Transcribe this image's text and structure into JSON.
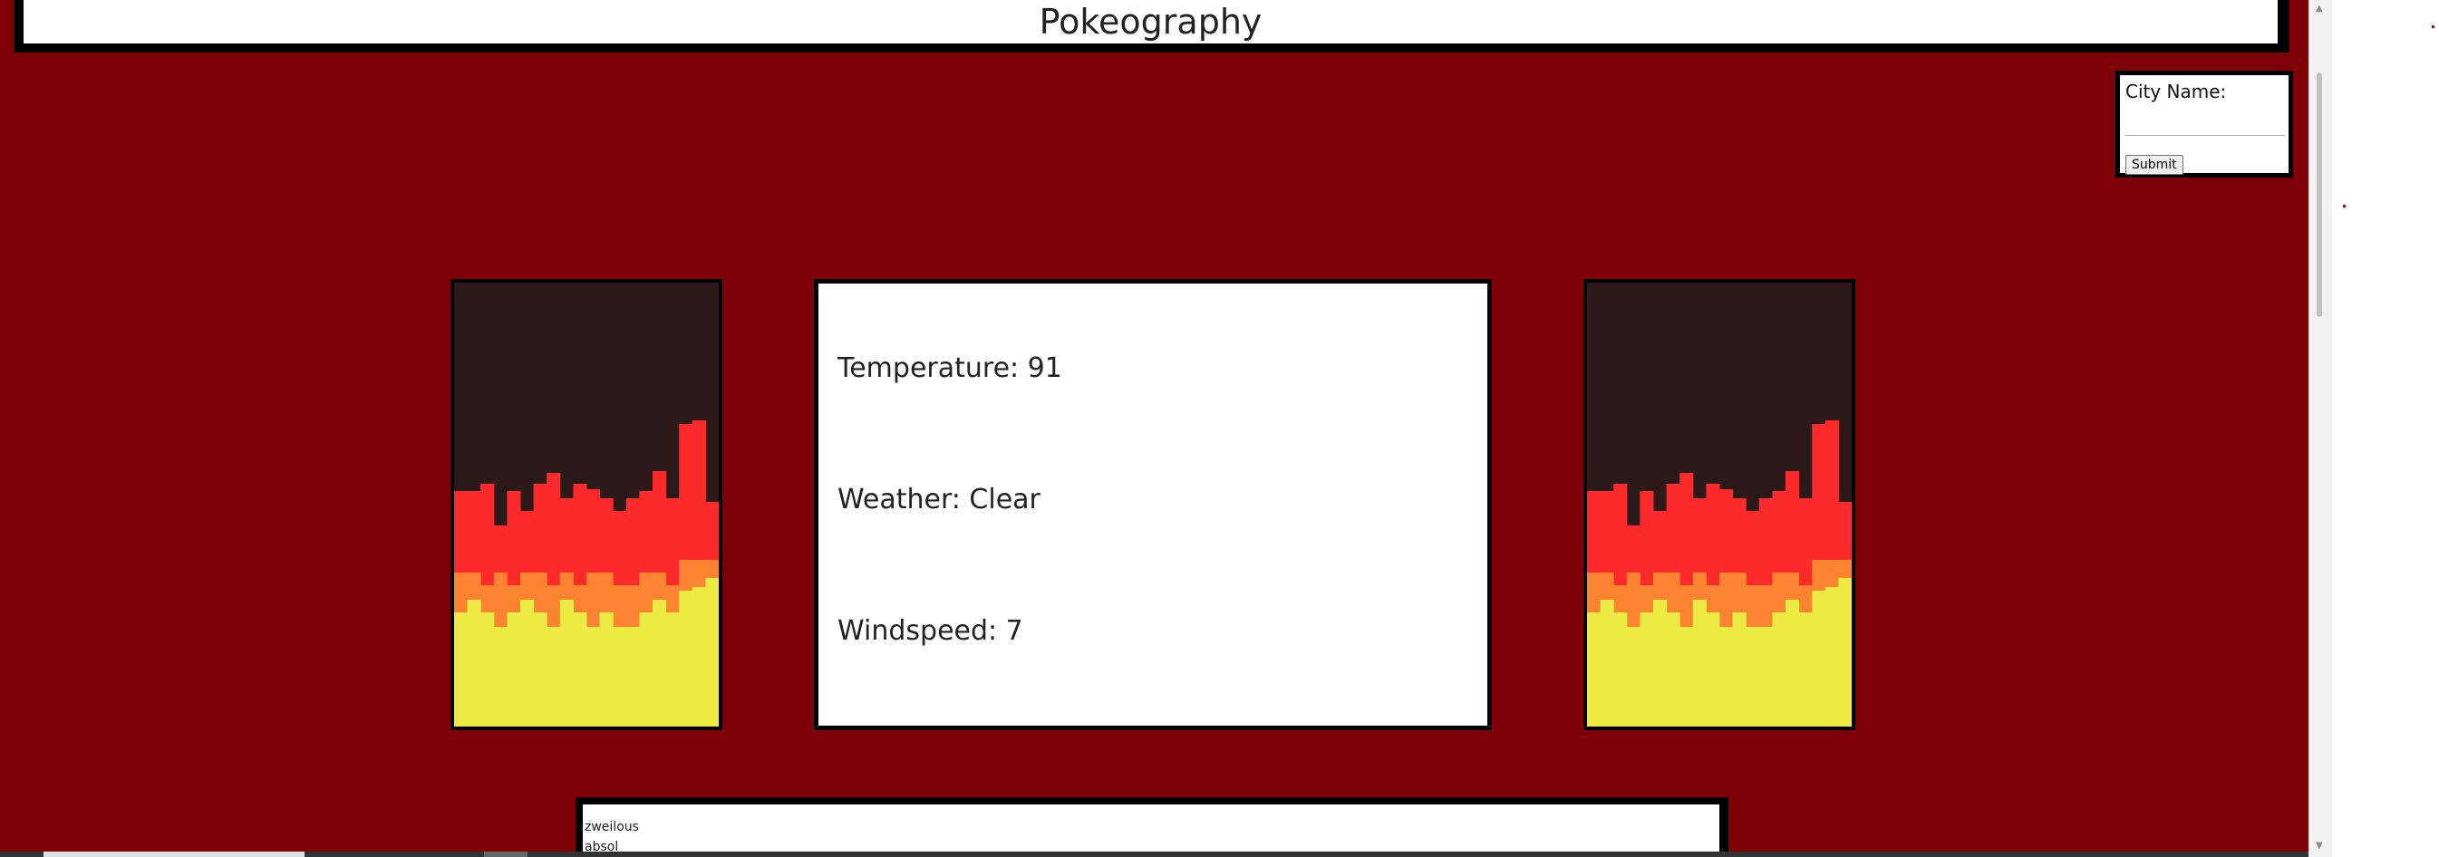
{
  "header": {
    "title": "Pokeography"
  },
  "city_form": {
    "label": "City Name:",
    "input_value": "",
    "submit_label": "Submit"
  },
  "weather": {
    "temperature": "Temperature: 91",
    "condition": "Weather: Clear",
    "windspeed": "Windspeed: 7"
  },
  "pokemon_list": [
    "zweilous",
    "absol"
  ],
  "colors": {
    "background": "#7e0107",
    "fire_dark": "#2c1919",
    "fire_red": "#fc2a2a",
    "fire_orange": "#fc8330",
    "fire_yellow": "#ecea43"
  }
}
